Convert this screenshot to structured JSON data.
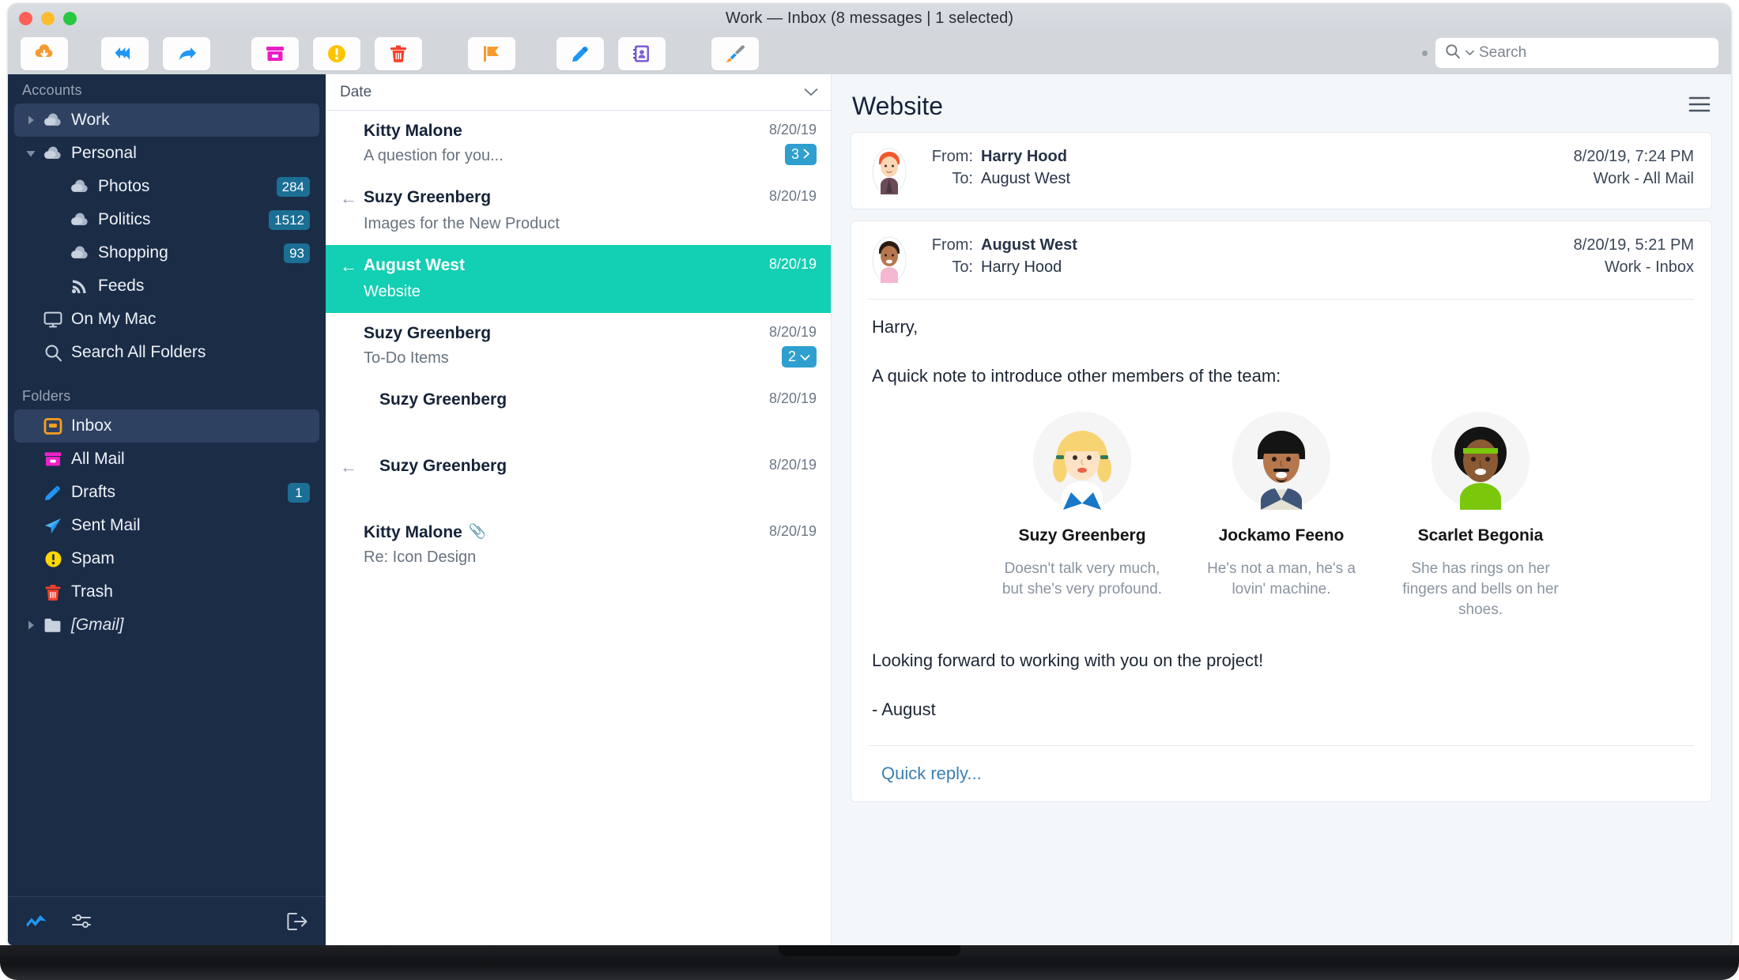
{
  "window": {
    "title": "Work — Inbox (8 messages | 1 selected)"
  },
  "toolbar": {
    "buttons": [
      {
        "name": "get-mail-button",
        "icon": "cloud-download-icon",
        "label": "Get Mail"
      },
      {
        "name": "reply-all-button",
        "icon": "reply-all-icon",
        "label": "Reply All"
      },
      {
        "name": "forward-button",
        "icon": "forward-icon",
        "label": "Forward"
      },
      {
        "name": "archive-button",
        "icon": "archive-icon",
        "label": "Archive"
      },
      {
        "name": "junk-button",
        "icon": "warning-circle-icon",
        "label": "Junk"
      },
      {
        "name": "delete-button",
        "icon": "trash-icon",
        "label": "Delete"
      },
      {
        "name": "flag-button",
        "icon": "flag-icon",
        "label": "Flag"
      },
      {
        "name": "compose-button",
        "icon": "pencil-icon",
        "label": "Compose"
      },
      {
        "name": "contacts-button",
        "icon": "address-book-icon",
        "label": "Contacts"
      },
      {
        "name": "cleanup-button",
        "icon": "paint-brush-icon",
        "label": "Clean Up"
      }
    ]
  },
  "search": {
    "placeholder": "Search",
    "value": "",
    "icon": "search-icon",
    "dropdown_icon": "chevron-down-icon"
  },
  "sidebar": {
    "accounts_header": "Accounts",
    "folders_header": "Folders",
    "accounts": [
      {
        "label": "Work",
        "icon": "cloud-icon",
        "twisty": "collapsed",
        "selected": true,
        "badge": "",
        "indent": 0
      },
      {
        "label": "Personal",
        "icon": "cloud-icon",
        "twisty": "expanded",
        "selected": false,
        "badge": "",
        "indent": 0
      },
      {
        "label": "Photos",
        "icon": "cloud-icon",
        "twisty": "none",
        "selected": false,
        "badge": "284",
        "indent": 1
      },
      {
        "label": "Politics",
        "icon": "cloud-icon",
        "twisty": "none",
        "selected": false,
        "badge": "1512",
        "indent": 1
      },
      {
        "label": "Shopping",
        "icon": "cloud-icon",
        "twisty": "none",
        "selected": false,
        "badge": "93",
        "indent": 1
      },
      {
        "label": "Feeds",
        "icon": "rss-icon",
        "twisty": "none",
        "selected": false,
        "badge": "",
        "indent": 1
      },
      {
        "label": "On My Mac",
        "icon": "monitor-icon",
        "twisty": "none",
        "selected": false,
        "badge": "",
        "indent": 0
      },
      {
        "label": "Search All Folders",
        "icon": "search-icon",
        "twisty": "none",
        "selected": false,
        "badge": "",
        "indent": 0
      }
    ],
    "folders": [
      {
        "label": "Inbox",
        "icon": "inbox-icon",
        "twisty": "none",
        "selected": true,
        "badge": "",
        "italic": false
      },
      {
        "label": "All Mail",
        "icon": "archive-icon",
        "twisty": "none",
        "selected": false,
        "badge": "",
        "italic": false
      },
      {
        "label": "Drafts",
        "icon": "pencil-icon",
        "twisty": "none",
        "selected": false,
        "badge": "1",
        "italic": false
      },
      {
        "label": "Sent Mail",
        "icon": "paper-plane-icon",
        "twisty": "none",
        "selected": false,
        "badge": "",
        "italic": false
      },
      {
        "label": "Spam",
        "icon": "warning-circle-icon",
        "twisty": "none",
        "selected": false,
        "badge": "",
        "italic": false
      },
      {
        "label": "Trash",
        "icon": "trash-icon",
        "twisty": "none",
        "selected": false,
        "badge": "",
        "italic": false
      },
      {
        "label": "[Gmail]",
        "icon": "folder-icon",
        "twisty": "collapsed",
        "selected": false,
        "badge": "",
        "italic": true
      }
    ],
    "footer": [
      {
        "name": "activity-icon",
        "label": "Activity"
      },
      {
        "name": "settings-sliders-icon",
        "label": "Settings"
      },
      {
        "name": "logout-icon",
        "label": "Log Out"
      }
    ]
  },
  "message_list": {
    "sort_label": "Date",
    "sort_chevron": "chevron-down-icon",
    "messages": [
      {
        "sender": "Kitty Malone",
        "subject": "A question for you...",
        "date": "8/20/19",
        "replied": false,
        "selected": false,
        "indent": false,
        "badge": "3",
        "badge_icon": "chevron-right-icon",
        "attachment": false
      },
      {
        "sender": "Suzy Greenberg",
        "subject": "Images for the New Product",
        "date": "8/20/19",
        "replied": true,
        "selected": false,
        "indent": false,
        "badge": "",
        "badge_icon": "",
        "attachment": false
      },
      {
        "sender": "August West",
        "subject": "Website",
        "date": "8/20/19",
        "replied": true,
        "selected": true,
        "indent": false,
        "badge": "",
        "badge_icon": "",
        "attachment": false
      },
      {
        "sender": "Suzy Greenberg",
        "subject": "To-Do Items",
        "date": "8/20/19",
        "replied": false,
        "selected": false,
        "indent": false,
        "badge": "2",
        "badge_icon": "chevron-down-icon",
        "attachment": false
      },
      {
        "sender": "Suzy Greenberg",
        "subject": "",
        "date": "8/20/19",
        "replied": false,
        "selected": false,
        "indent": true,
        "badge": "",
        "badge_icon": "",
        "attachment": false
      },
      {
        "sender": "Suzy Greenberg",
        "subject": "",
        "date": "8/20/19",
        "replied": true,
        "selected": false,
        "indent": true,
        "badge": "",
        "badge_icon": "",
        "attachment": false
      },
      {
        "sender": "Kitty Malone",
        "subject": "Re: Icon Design",
        "date": "8/20/19",
        "replied": false,
        "selected": false,
        "indent": false,
        "badge": "",
        "badge_icon": "",
        "attachment": true
      }
    ]
  },
  "reader": {
    "title": "Website",
    "menu_icon": "hamburger-menu-icon",
    "messages": [
      {
        "avatar": "harry-hood-avatar",
        "from_label": "From:",
        "from": "Harry Hood",
        "to_label": "To:",
        "to": "August West",
        "datetime": "8/20/19, 7:24 PM",
        "mailbox": "Work - All Mail",
        "expanded": false
      },
      {
        "avatar": "august-west-avatar",
        "from_label": "From:",
        "from": "August West",
        "to_label": "To:",
        "to": "Harry Hood",
        "datetime": "8/20/19, 5:21 PM",
        "mailbox": "Work - Inbox",
        "expanded": true
      }
    ],
    "body": {
      "greeting": "Harry,",
      "intro": "A quick note to introduce other members of the team:",
      "team": [
        {
          "name": "Suzy Greenberg",
          "desc": "Doesn't talk very much, but she's very profound.",
          "avatar": "suzy-greenberg-avatar"
        },
        {
          "name": "Jockamo Feeno",
          "desc": "He's not a man, he's a lovin' machine.",
          "avatar": "jockamo-feeno-avatar"
        },
        {
          "name": "Scarlet Begonia",
          "desc": "She has rings on her fingers and bells on her shoes.",
          "avatar": "scarlet-begonia-avatar"
        }
      ],
      "closing": "Looking forward to working with you on the project!",
      "signature": "- August"
    },
    "quick_reply": "Quick reply..."
  },
  "colors": {
    "sidebar_bg": "#1b2c47",
    "selection": "#13cfb3",
    "badge_blue": "#1b6e94",
    "thread_badge": "#2f9fd0",
    "accent_orange": "#f5a623",
    "link": "#3c7fb1"
  }
}
